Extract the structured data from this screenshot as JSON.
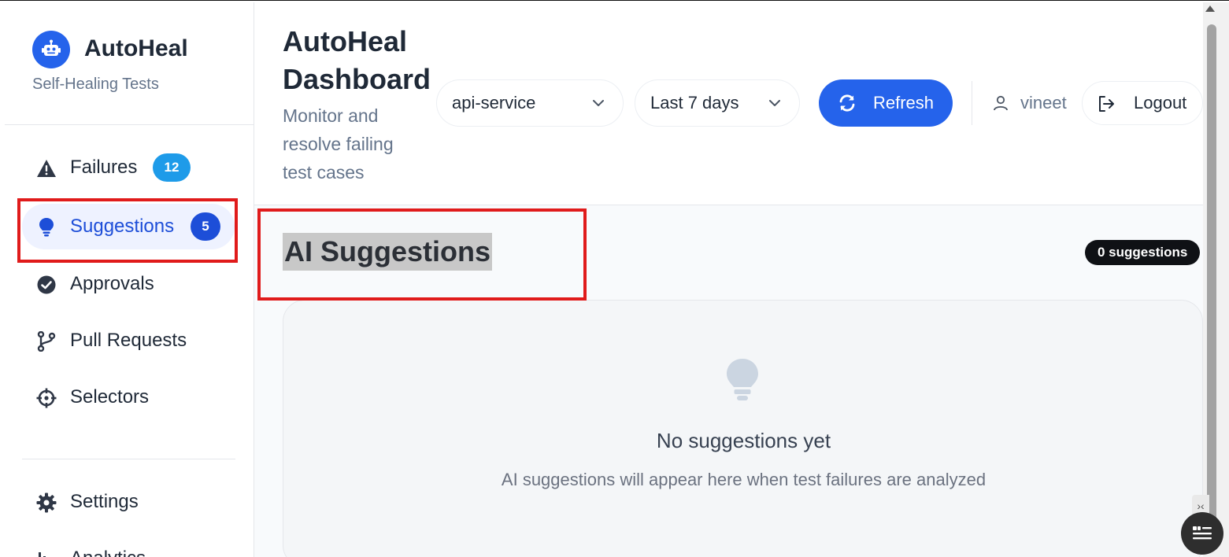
{
  "brand": {
    "name": "AutoHeal",
    "subtitle": "Self-Healing Tests",
    "logo_icon": "robot-icon"
  },
  "sidebar": {
    "items": [
      {
        "label": "Failures",
        "icon": "warning-triangle-icon",
        "badge": "12",
        "active": false
      },
      {
        "label": "Suggestions",
        "icon": "lightbulb-icon",
        "badge": "5",
        "active": true
      },
      {
        "label": "Approvals",
        "icon": "check-circle-icon",
        "active": false
      },
      {
        "label": "Pull Requests",
        "icon": "git-branch-icon",
        "active": false
      },
      {
        "label": "Selectors",
        "icon": "crosshair-icon",
        "active": false
      }
    ],
    "bottom_items": [
      {
        "label": "Settings",
        "icon": "gear-icon"
      },
      {
        "label": "Analytics",
        "icon": "bar-chart-icon"
      }
    ]
  },
  "header": {
    "title": "AutoHeal Dashboard",
    "subtitle": "Monitor and resolve failing test cases",
    "service_select": "api-service",
    "range_select": "Last 7 days",
    "refresh_label": "Refresh",
    "username": "vineet",
    "logout_label": "Logout"
  },
  "main": {
    "section_title": "AI Suggestions",
    "count_label": "0 suggestions",
    "empty_title": "No suggestions yet",
    "empty_subtitle": "AI suggestions will appear here when test failures are analyzed"
  },
  "colors": {
    "accent": "#2563eb",
    "badge_sky": "#1e9be9",
    "highlight_red": "#e01b1b"
  }
}
